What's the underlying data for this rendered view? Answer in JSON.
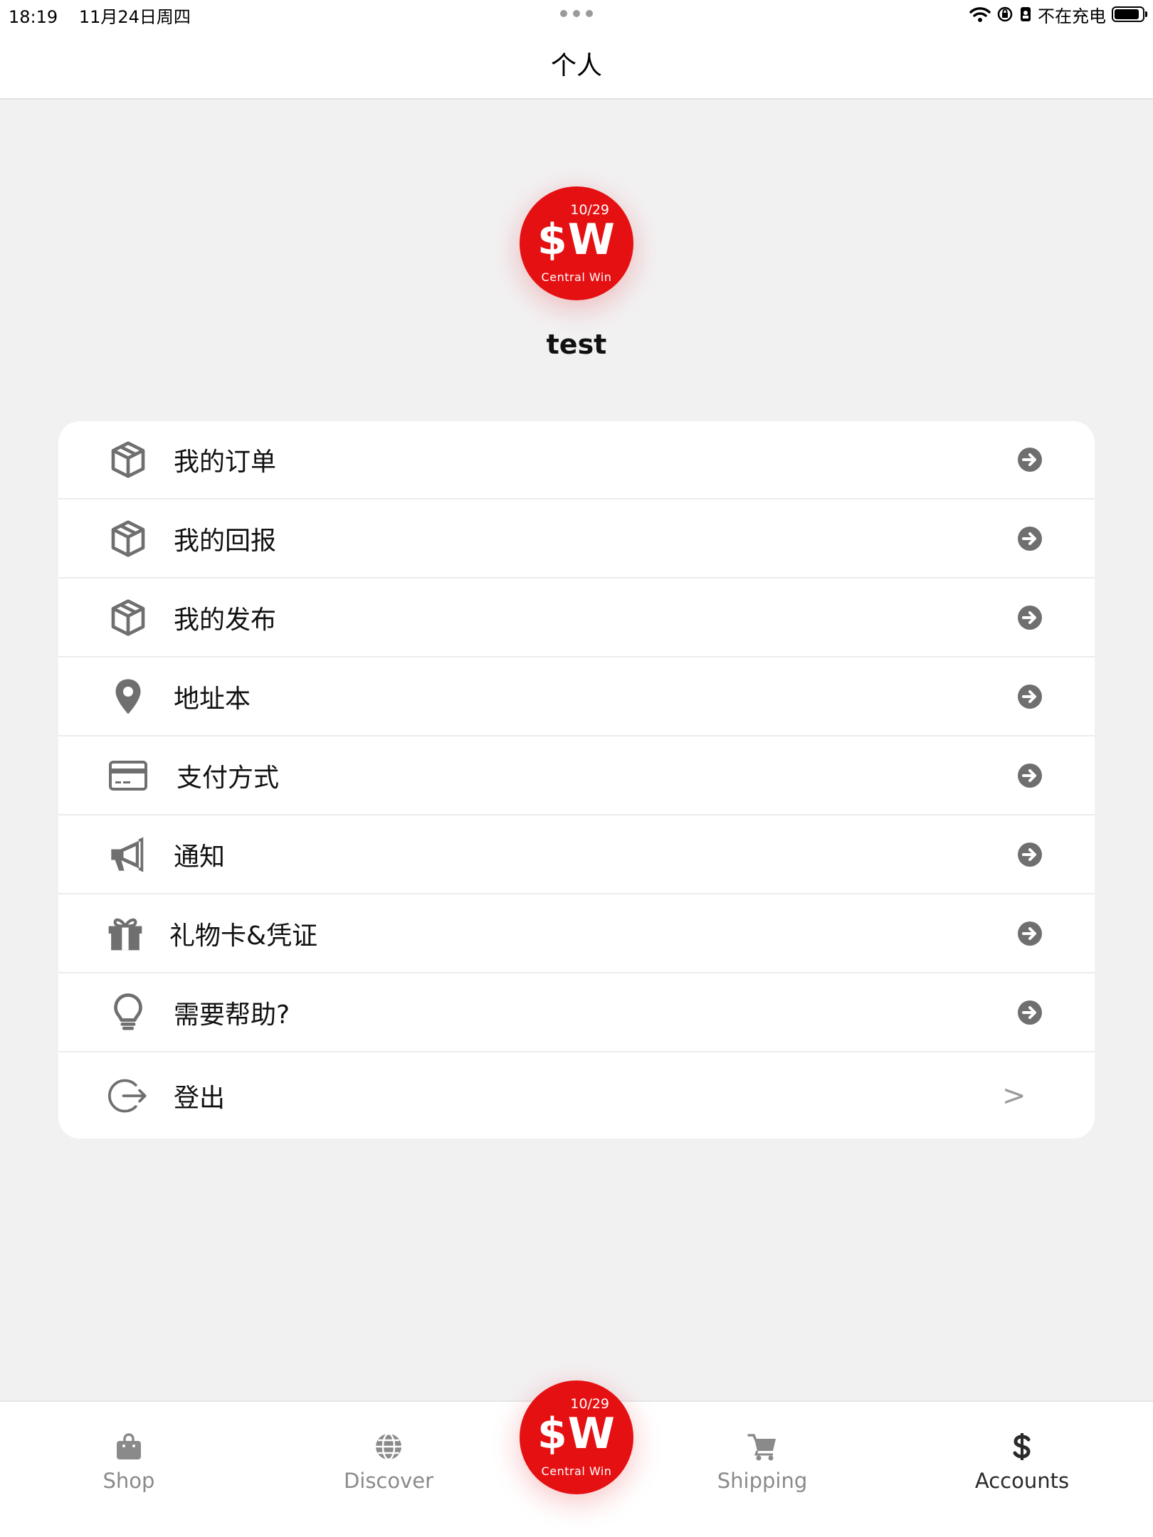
{
  "status_bar": {
    "time": "18:19",
    "date": "11月24日周四",
    "charging_text": "不在充电",
    "battery_level": 0.9
  },
  "nav": {
    "title": "个人"
  },
  "brand": {
    "date": "10/29",
    "mark": "$W",
    "name": "Central Win",
    "color": "#e51012"
  },
  "profile": {
    "username": "test"
  },
  "menu": {
    "items": [
      {
        "label": "我的订单",
        "icon": "package-icon",
        "trailing": "arrow-circle-right-icon"
      },
      {
        "label": "我的回报",
        "icon": "package-icon",
        "trailing": "arrow-circle-right-icon"
      },
      {
        "label": "我的发布",
        "icon": "package-icon",
        "trailing": "arrow-circle-right-icon"
      },
      {
        "label": "地址本",
        "icon": "map-pin-icon",
        "trailing": "arrow-circle-right-icon"
      },
      {
        "label": "支付方式",
        "icon": "credit-card-icon",
        "trailing": "arrow-circle-right-icon"
      },
      {
        "label": "通知",
        "icon": "megaphone-icon",
        "trailing": "arrow-circle-right-icon"
      },
      {
        "label": "礼物卡&凭证",
        "icon": "gift-icon",
        "trailing": "arrow-circle-right-icon"
      },
      {
        "label": "需要帮助?",
        "icon": "lightbulb-icon",
        "trailing": "arrow-circle-right-icon"
      },
      {
        "label": "登出",
        "icon": "logout-icon",
        "trailing": ">"
      }
    ]
  },
  "tabs": [
    {
      "label": "Shop",
      "icon": "shopping-bag-icon",
      "active": false
    },
    {
      "label": "Discover",
      "icon": "globe-icon",
      "active": false
    },
    {
      "label": "Shipping",
      "icon": "cart-icon",
      "active": false
    },
    {
      "label": "Accounts",
      "icon": "dollar-icon",
      "active": true
    }
  ]
}
